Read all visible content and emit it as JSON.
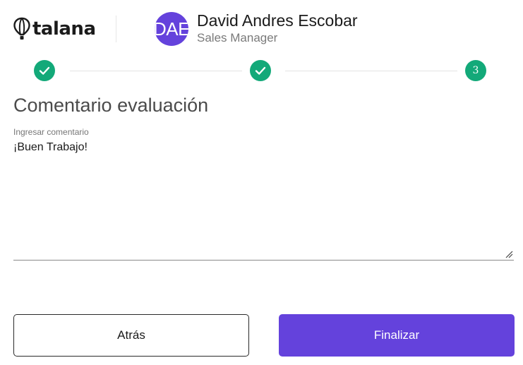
{
  "brand": {
    "name": "talana",
    "accent_color": "#6442dc",
    "success_color": "#13a979"
  },
  "user": {
    "initials": "DAE",
    "name": "David Andres Escobar",
    "role": "Sales Manager"
  },
  "stepper": {
    "steps": [
      {
        "state": "completed",
        "icon": "check-icon"
      },
      {
        "state": "completed",
        "icon": "check-icon"
      },
      {
        "state": "current",
        "label": "3"
      }
    ]
  },
  "comment_section": {
    "title": "Comentario evaluación",
    "label": "Ingresar comentario",
    "value": "¡Buen Trabajo!"
  },
  "actions": {
    "back_label": "Atrás",
    "finish_label": "Finalizar"
  }
}
